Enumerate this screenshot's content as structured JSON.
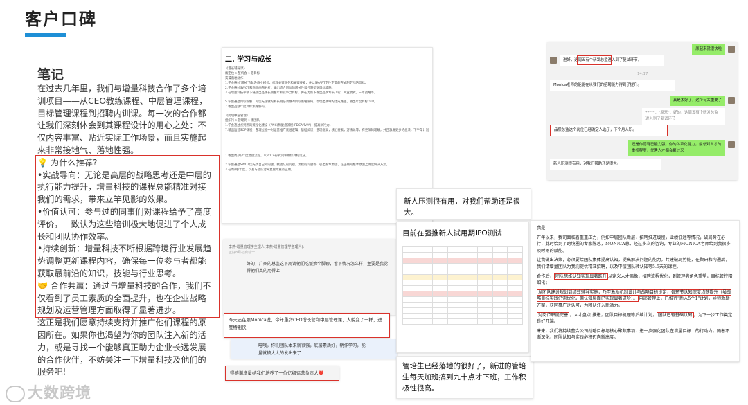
{
  "page": {
    "title": "客户口碑",
    "accent_color": "#1e8fd6",
    "highlight_color": "#d9322b"
  },
  "notes": {
    "heading": "笔记",
    "intro": "在过去几年里，我们与增量科技合作了多个培训项目——从CEO教练课程、中层管理课程，目标管理课程到招聘内训课。每一次的合作都让我们深刻体会到其课程设计的用心之处：不仅内容丰富、贴近实际工作场景，而且实施起来非常接地气、落地性强。",
    "recommend_title": "💡 为什么推荐?",
    "point1": "•实战导向：无论是高层的战略思考还是中层的执行能力提升，增量科技的课程总能精准对接我们的需求，带来立竿见影的效果。",
    "point2": "•价值认可：参与过的同事们对课程给予了高度评价，一致认为这些培训极大地促进了个人成长和团队协作效率。",
    "point3": "•持续创新：增量科技不断根据跨境行业发展趋势调整更新课程内容，确保每一位参与者都能获取最前沿的知识，技能与行业思考。",
    "point4": "🤝 合作共赢：通过与增量科技的合作，我们不仅看到了员工素质的全面提升，也在企业战略规划及运营管理方面取得了显著进步。",
    "closing": "这正是我们愿意持续支持并推广他们课程的原因所在。如果你也渴望为你的团队注入新的活力，或是寻找一个能够真正助力企业长远发展的合作伙伴，不妨关注一下增量科技及他们的服务吧!"
  },
  "watermark": {
    "text": "大数跨境"
  },
  "doc": {
    "heading": "二. 学习与成长",
    "lines": [
      "《增长辅导课》",
      "痛定位->整机会->定目标",
      "实操落地动作",
      "1.学会通过'增长'飞轮及商业模式，梳理关键业务和关键要素，并以SMART定性定量的方式制定战略目标。",
      "2.学会通过SWOT和商业画布分析，输出适合团队的增长性和控制型季目标策略。",
      "3.在增量科技带领下链接出品线长期整年和竞争力目标，并在为新下输出品牌专长飞轮，商业模式，三年战略等。",
      "",
      "5.学会通过目标拆解，对优先级做的和长期必须做的目标策略解码，梳理出清晰的达成路径，输出年度目标OTP。",
      "7.输出品线年度目标策略解码。",
      "",
      "《跨境中层管理》",
      "组织行->管理到->建团队",
      "1.学会通过点到点的流程化建设（PNC)和复盘流程(PDCA/RAA)，提高执行力。",
      "7.输出运营SOP课程，整理过程中对运营推广底层逻辑，基础知识，整理框架，核心要素，方法论等，有更深的理解，并且激发更多的想法，下半年计划团队内分享培训和知识。"
    ],
    "lines2": [
      "1.输出周/月/年度复盘流程，以PDCA形式闭环确保目标达成。",
      "",
      "2.学会通过SWOT优先找自己的问题，找团队的问题，流程的问题等，引出根本原因，在正确的根本原因上确定解决方案。",
      "3.在周/月/年度，以及与团队讨开复盘时重点应用。"
    ]
  },
  "chat": {
    "header": "李燕-增量管理学主理人(李燕-增量管理学主理人):",
    "sub": "正好8月初启动一",
    "body": "好的，广州的总监这下周请他们吃饭换个脚聊，看下情况怎么样，主要是我觉得他们真的用得上"
  },
  "monica_card": {
    "text": "昨天还在跟Monica说，今年重拜CEO增长营和中层管理课，人貌变了一样，进度特别快"
  },
  "team_card": {
    "text": "哇哦，你们团队本来就很强，底层素质好，稍作学习，能量就被大大的发出来了"
  },
  "thanks_card": {
    "text": "得感谢增量给我们培养了一位亿级运营负责人❤️"
  },
  "wechat": {
    "m1": "原起来就很快啦",
    "m2": "进好，这周五有个研发总监进入到了复试环节。",
    "time": "14:17",
    "m3": "Monica老师的能能在以我们的招聘能力得到了提升。",
    "m4": "真是太好了，这个有太重要了",
    "m5": "*****：\"原来\"：好的，这周五有个研发总监进入到了复试环节",
    "m6": "品质总监这个岗位已经确定人选了，下个月入职。",
    "m7": "还是你们有已能力强，你的体系化能力，最总对人才的重视程度，优秀人才都会聚过来",
    "m8": "新人压测很有用，对我们帮助还是很大。"
  },
  "comment_card": {
    "text": "新人压测很有用，对我们帮助还是很大。"
  },
  "ipo_card": {
    "title": "目前在强推新人试用期IPO测试"
  },
  "manager_card": {
    "text": "管培生已经落地的很好了，新进的管培生每天加班搞到九十点才下班，工作积极性很高。"
  },
  "letter": {
    "salutation": "我是",
    "p1": "开年以来，我司面临着重重压力，例如中层团队断层，招聘推进缓慢，业绩低迷等情况，破局势在必行，此时恰到了跨境圈的专家陈总，MONICA总，经过多次的咨询，专业的MONICA老师给到我很多及时雨的赋能。",
    "p2": "让我做出决策，必须要给团队集体提高认知，提高解决问题的能力，共建破局势能，在顾研和沟通后，我们请增量团队为我们提供精准招聘，以及中层团队转认知等5.5天的课程。",
    "p3_a": "合作后，",
    "p3_box": "团队思维认知实现显著跃升",
    "p3_b": "从定义人才画像，招聘流程优化，到管理者角色重塑，目标管控精细化；",
    "p4_box": "从团队建设规划到绩效辅导实施，乃至激励机制设计与战略目标设定，各环节认知深度均获提升（虽战略目标实践仍需优化，但认知层面已实现显著进阶）。",
    "p4_b": "内部管理上，已推行\"新人5个1\"计划，导师激励方案，获同事广泛认可，为团队注入新活力。",
    "p5_box1": "对岗位职能完善",
    "p5_a": "，人才盘点 推进，团队目标机理等后续计划，",
    "p5_box2": "团队已有基础认知",
    "p5_b": "，为下一步工作奠定良好开端。",
    "p6": "未来，我们将持续整合公司战略目标与核心聚焦事项，进一步强化团队在增量目标上的行动力，随着不断深化，团队认知与实践必将迈向新高度。"
  }
}
